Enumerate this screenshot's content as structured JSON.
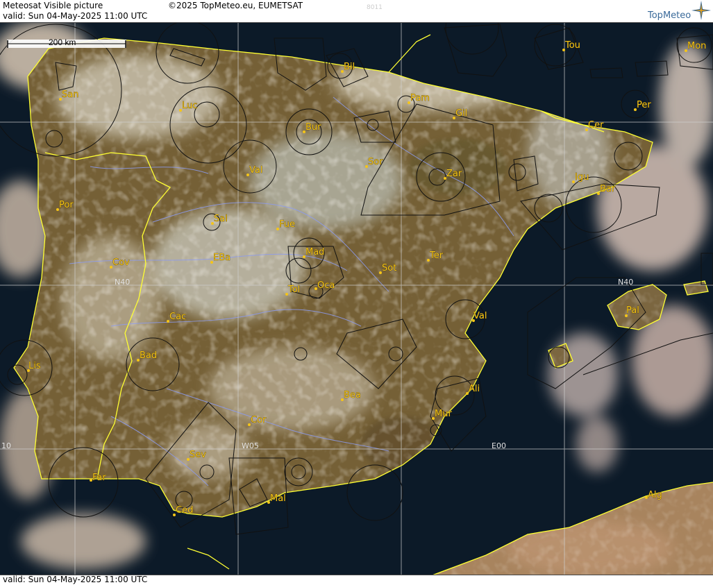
{
  "header": {
    "title": "Meteosat Visible picture",
    "copyright": "©2025 TopMeteo.eu, EUMETSAT",
    "valid": "valid:  Sun  04-May-2025  11:00 UTC",
    "faint_code": "8011",
    "brand": "TopMeteo"
  },
  "footer": {
    "valid": "valid:  Sun  04-May-2025  11:00 UTC"
  },
  "scale": {
    "label": "200 km"
  },
  "grid_labels": {
    "n40_left": "N40",
    "n40_right": "N40",
    "w05": "W05",
    "e00": "E00",
    "w10": "10"
  },
  "cities": {
    "San": "San",
    "Luc": "Luc",
    "Bil": "Bil",
    "Pam": "Pam",
    "Tou": "Tou",
    "Mon": "Mon",
    "Per": "Per",
    "Cer": "Cer",
    "Gil": "Gil",
    "Bur": "Bur",
    "Val_n": "Val",
    "Sor": "Sor",
    "Zar": "Zar",
    "Igu": "Igu",
    "Bar": "Bar",
    "Por": "Por",
    "Sal": "Sal",
    "Fue": "Fue",
    "Cov": "Cov",
    "EBa": "EBa",
    "Mad": "Mad",
    "Sot": "Sot",
    "Ter": "Ter",
    "Tol": "Tol",
    "Oca": "Oca",
    "Pal": "Pal",
    "Cac": "Cac",
    "Val_e": "Val",
    "Lis": "Lis",
    "Bad": "Bad",
    "Ali": "Ali",
    "Bea": "Bea",
    "Mur": "Mur",
    "Cor": "Cor",
    "Sev": "Sev",
    "Far": "Far",
    "Mal": "Mal",
    "Ced": "Ced",
    "Alg": "Alg"
  },
  "colors": {
    "sea": "#0c1a28",
    "land": "#6e5b34",
    "label": "#f5c518",
    "border": "#ffff33",
    "airspace": "#111111"
  }
}
